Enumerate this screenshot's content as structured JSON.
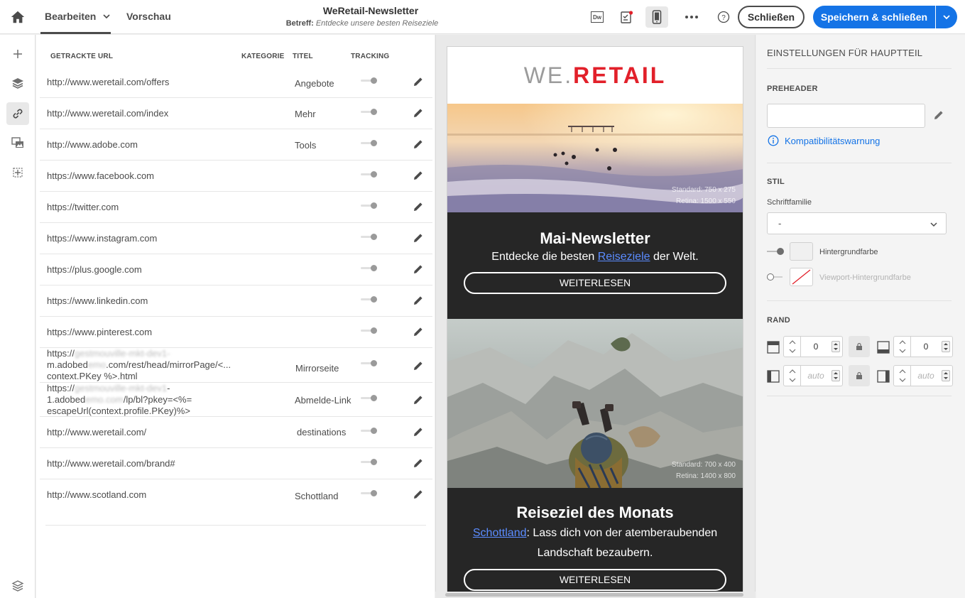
{
  "topbar": {
    "tab_edit": "Bearbeiten",
    "tab_preview": "Vorschau",
    "doc_title": "WeRetail-Newsletter",
    "subject_label": "Betreff:",
    "subject_value": "Entdecke unsere besten Reiseziele",
    "dw_label": "Dw",
    "close_label": "Schließen",
    "save_label": "Speichern & schließen",
    "help_label": "?"
  },
  "linktable": {
    "headers": {
      "url": "GETRACKTE URL",
      "category": "KATEGORIE",
      "title": "TITEL",
      "tracking": "TRACKING"
    },
    "rows": [
      {
        "url1": "http://www.weretail.com/offers",
        "title": "Angebote"
      },
      {
        "url1": "http://www.weretail.com/index",
        "title": "Mehr"
      },
      {
        "url1": "http://www.adobe.com",
        "title": "Tools"
      },
      {
        "url1": "https://www.facebook.com",
        "title": ""
      },
      {
        "url1": "https://twitter.com",
        "title": ""
      },
      {
        "url1": "https://www.instagram.com",
        "title": ""
      },
      {
        "url1": "https://plus.google.com",
        "title": ""
      },
      {
        "url1": "https://www.linkedin.com",
        "title": ""
      },
      {
        "url1": "https://www.pinterest.com",
        "title": ""
      },
      {
        "url1a": "https://",
        "url1b": "gestmouville-mkt-dev1-",
        "url2a": "m.adobed",
        "url2b": "emo",
        "url2c": ".com/rest/head/mirrorPage/<...",
        "url3": "context.PKey %>.html",
        "title": "Mirrorseite"
      },
      {
        "url1a": "https://",
        "url1b": "gestmouville-mkt-dev1",
        "url1c": "-",
        "url2a": "1.adobed",
        "url2b": "emo.com",
        "url2c": "/lp/bl?pkey=<%=",
        "url3": "escapeUrl(context.profile.PKey)%>",
        "title": "Abmelde-Link"
      },
      {
        "url1": "http://www.weretail.com/",
        "title": "destinations"
      },
      {
        "url1": "http://www.weretail.com/brand#",
        "title": ""
      },
      {
        "url1": "http://www.scotland.com",
        "title": "Schottland"
      }
    ]
  },
  "email": {
    "logo_we": "WE",
    "logo_dot": ".",
    "logo_retail": "RETAIL",
    "hero_note1": "Standard: 750 x 275",
    "hero_note2": "Retina: 1500 x 550",
    "block1_title": "Mai-Newsletter",
    "block1_pre": "Entdecke die besten ",
    "block1_link": "Reiseziele",
    "block1_post": " der Welt.",
    "block1_button": "WEITERLESEN",
    "mountain_note1": "Standard: 700 x 400",
    "mountain_note2": "Retina: 1400 x 800",
    "block2_title": "Reiseziel des Monats",
    "block2_link": "Schottland",
    "block2_text1": ": Lass dich von der atemberaubenden",
    "block2_text2": "Landschaft bezaubern.",
    "block2_button": "WEITERLESEN"
  },
  "settings": {
    "title": "EINSTELLUNGEN FÜR HAUPTTEIL",
    "preheader_h": "PREHEADER",
    "preheader_value": "",
    "compat_link": "Kompatibilitätswarnung",
    "style_h": "STIL",
    "font_family_label": "Schriftfamilie",
    "font_family_value": "-",
    "bg_color_label": "Hintergrundfarbe",
    "viewport_bg_label": "Viewport-Hintergrundfarbe",
    "border_h": "RAND",
    "top_value": "0",
    "bottom_value": "0",
    "left_placeholder": "auto",
    "right_placeholder": "auto"
  },
  "colors": {
    "accent": "#1473e6",
    "brand_red": "#e2202a",
    "dark_block": "#262626"
  }
}
